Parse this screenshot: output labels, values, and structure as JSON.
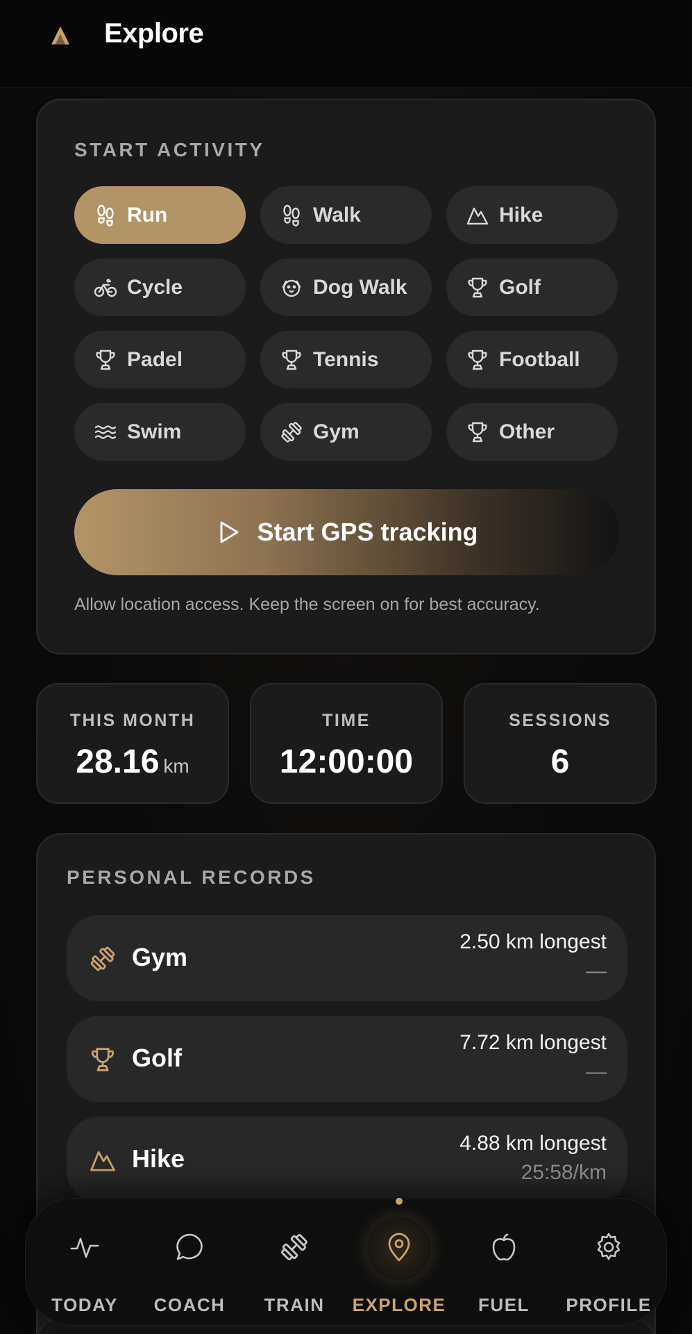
{
  "header": {
    "title": "Explore",
    "logo_icon": "app-logo-icon"
  },
  "start_activity": {
    "label": "START ACTIVITY",
    "selected": "Run",
    "activities": [
      {
        "label": "Run",
        "icon": "footprints-icon"
      },
      {
        "label": "Walk",
        "icon": "footprints-icon"
      },
      {
        "label": "Hike",
        "icon": "mountain-icon"
      },
      {
        "label": "Cycle",
        "icon": "bike-icon"
      },
      {
        "label": "Dog Walk",
        "icon": "dog-icon"
      },
      {
        "label": "Golf",
        "icon": "trophy-icon"
      },
      {
        "label": "Padel",
        "icon": "trophy-icon"
      },
      {
        "label": "Tennis",
        "icon": "trophy-icon"
      },
      {
        "label": "Football",
        "icon": "trophy-icon"
      },
      {
        "label": "Swim",
        "icon": "waves-icon"
      },
      {
        "label": "Gym",
        "icon": "dumbbell-icon"
      },
      {
        "label": "Other",
        "icon": "trophy-icon"
      }
    ],
    "gps_button": "Start GPS tracking",
    "hint": "Allow location access. Keep the screen on for best accuracy."
  },
  "stats": {
    "month": {
      "label": "THIS MONTH",
      "value": "28.16",
      "unit": "km"
    },
    "time": {
      "label": "TIME",
      "value": "12:00:00"
    },
    "sessions": {
      "label": "SESSIONS",
      "value": "6"
    }
  },
  "records": {
    "label": "PERSONAL RECORDS",
    "items": [
      {
        "name": "Gym",
        "icon": "dumbbell-icon",
        "main": "2.50 km longest",
        "sub": "—"
      },
      {
        "name": "Golf",
        "icon": "trophy-icon",
        "main": "7.72 km longest",
        "sub": "—"
      },
      {
        "name": "Hike",
        "icon": "mountain-icon",
        "main": "4.88 km longest",
        "sub": "25:58/km"
      }
    ]
  },
  "nav": {
    "active": "EXPLORE",
    "items": [
      {
        "label": "TODAY",
        "icon": "activity-icon"
      },
      {
        "label": "COACH",
        "icon": "chat-bubble-icon"
      },
      {
        "label": "TRAIN",
        "icon": "dumbbell-icon"
      },
      {
        "label": "EXPLORE",
        "icon": "map-pin-icon"
      },
      {
        "label": "FUEL",
        "icon": "apple-icon"
      },
      {
        "label": "PROFILE",
        "icon": "gear-icon"
      }
    ]
  },
  "colors": {
    "accent": "#b39466",
    "accent_text": "#c9a36f",
    "card": "#1b1b1b",
    "chip": "#2a2a2a"
  }
}
